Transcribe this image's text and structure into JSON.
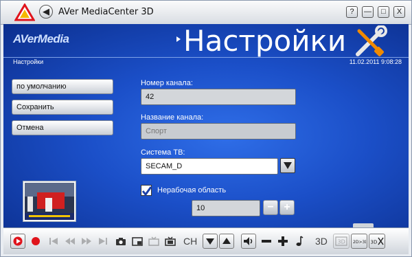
{
  "window": {
    "title": "AVer MediaCenter 3D",
    "controls": {
      "help": "?",
      "minimize": "—",
      "maximize": "□",
      "close": "X"
    }
  },
  "header": {
    "brand": "AVerMedia",
    "page_title": "Настройки",
    "breadcrumb": "Настройки",
    "datetime": "11.02.2011 9:08:28"
  },
  "sidebar": {
    "buttons": [
      {
        "label": "по умолчанию"
      },
      {
        "label": "Сохранить"
      },
      {
        "label": "Отмена"
      }
    ]
  },
  "form": {
    "channel_number": {
      "label": "Номер канала:",
      "value": "42"
    },
    "channel_name": {
      "label": "Название канала:",
      "value": "Спорт"
    },
    "tv_system": {
      "label": "Система ТВ:",
      "value": "SECAM_D"
    },
    "inactive_area": {
      "label": "Нерабочая область",
      "checked": true,
      "value": "10"
    }
  },
  "controlbar": {
    "ch_label": "CH",
    "label_3d": "3D"
  },
  "colors": {
    "accent_blue": "#1b4fc8",
    "record_red": "#e0141c"
  }
}
